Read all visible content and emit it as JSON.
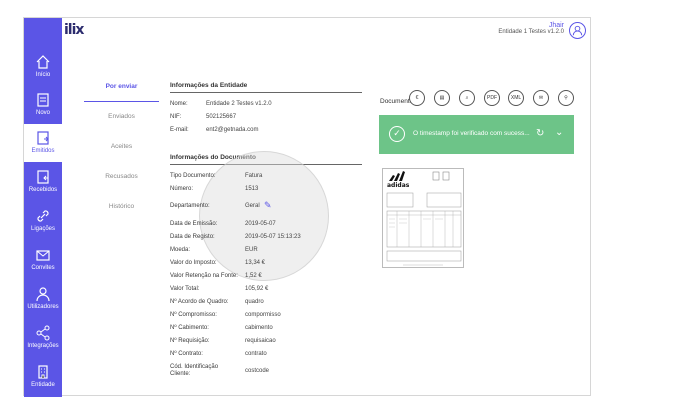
{
  "app": {
    "logo": "ilix"
  },
  "user": {
    "name": "Jhair",
    "entity": "Entidade 1 Testes v1.2.0"
  },
  "sidebar": {
    "items": [
      {
        "label": "Início",
        "icon": "home-icon",
        "active": false
      },
      {
        "label": "Novo",
        "icon": "new-document-icon",
        "active": false
      },
      {
        "label": "Emitidos",
        "icon": "issued-document-icon",
        "active": true
      },
      {
        "label": "Recebidos",
        "icon": "received-document-icon",
        "active": false
      },
      {
        "label": "Ligações",
        "icon": "link-icon",
        "active": false
      },
      {
        "label": "Convites",
        "icon": "envelope-icon",
        "active": false
      },
      {
        "label": "Utilizadores",
        "icon": "user-icon",
        "active": false
      },
      {
        "label": "Integrações",
        "icon": "share-icon",
        "active": false
      },
      {
        "label": "Entidade",
        "icon": "building-icon",
        "active": false
      }
    ]
  },
  "tabs": [
    {
      "label": "Por enviar",
      "active": true
    },
    {
      "label": "Enviados",
      "active": false
    },
    {
      "label": "Aceites",
      "active": false
    },
    {
      "label": "Recusados",
      "active": false
    },
    {
      "label": "Histórico",
      "active": false
    }
  ],
  "entity_info": {
    "title": "Informações da Entidade",
    "rows": [
      {
        "label": "Nome:",
        "value": "Entidade 2 Testes v1.2.0"
      },
      {
        "label": "NIF:",
        "value": "502125667"
      },
      {
        "label": "E-mail:",
        "value": "ent2@getnada.com"
      }
    ]
  },
  "document_info": {
    "title": "Informações do Documento",
    "rows": [
      {
        "label": "Tipo Documento:",
        "value": "Fatura"
      },
      {
        "label": "Número:",
        "value": "1513"
      },
      {
        "label": "Departamento:",
        "value": "Geral"
      },
      {
        "label": "Data de Emissão:",
        "value": "2019-05-07"
      },
      {
        "label": "Data de Registo:",
        "value": "2019-05-07 15:13:23"
      },
      {
        "label": "Moeda:",
        "value": "EUR"
      },
      {
        "label": "Valor do Imposto:",
        "value": "13,34 €"
      },
      {
        "label": "Valor Retenção na Fonte:",
        "value": "1,52 €"
      },
      {
        "label": "Valor Total:",
        "value": "105,92 €"
      },
      {
        "label": "Nº Acordo de Quadro:",
        "value": "quadro"
      },
      {
        "label": "Nº Compromisso:",
        "value": "compormisso"
      },
      {
        "label": "Nº Cabimento:",
        "value": "cabimento"
      },
      {
        "label": "Nº Requisição:",
        "value": "requisaicao"
      },
      {
        "label": "Nº Contrato:",
        "value": "contrato"
      },
      {
        "label": "Cód. Identificação Cliente:",
        "value": "costcode"
      }
    ]
  },
  "document_panel": {
    "label": "Documento",
    "actions": [
      {
        "label": "€",
        "icon": "euro-icon"
      },
      {
        "label": "▤",
        "icon": "copy-icon"
      },
      {
        "label": "⌕",
        "icon": "search-icon"
      },
      {
        "label": "PDF",
        "icon": "pdf-icon"
      },
      {
        "label": "XML",
        "icon": "xml-icon"
      },
      {
        "label": "✉",
        "icon": "email-icon"
      },
      {
        "label": "⚲",
        "icon": "link-icon"
      }
    ],
    "banner": "O timestamp foi verificado com sucess...",
    "thumbnail_brand": "adidas"
  },
  "colors": {
    "primary": "#5b55e6",
    "success": "#6dc488"
  }
}
